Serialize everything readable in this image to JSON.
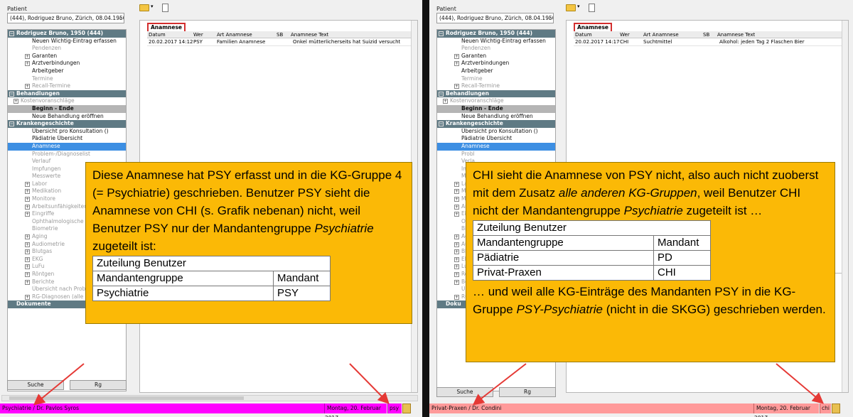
{
  "left": {
    "patient_label": "Patient",
    "patient_value": "(444), Rodriguez Bruno, Zürich, 08.04.1950, €",
    "tree": [
      {
        "kind": "hdr",
        "toggle": "⊟",
        "text": "Rodriguez Bruno, 1950 (444)"
      },
      {
        "kind": "item",
        "text": "Neuen Wichtig-Eintrag erfassen"
      },
      {
        "kind": "dis",
        "text": "Pendenzen"
      },
      {
        "kind": "item",
        "toggle": "+",
        "text": "Garanten"
      },
      {
        "kind": "item",
        "toggle": "+",
        "text": "Arztverbindungen"
      },
      {
        "kind": "item",
        "text": "Arbeitgeber"
      },
      {
        "kind": "dis",
        "text": "Termine"
      },
      {
        "kind": "dis",
        "toggle": "+",
        "text": "Recall-Termine"
      },
      {
        "kind": "hdr",
        "toggle": "⊟",
        "text": "Behandlungen"
      },
      {
        "kind": "dis2",
        "toggle": "+",
        "text": "Kostenvoranschläge"
      },
      {
        "kind": "hdr2",
        "text": "Beginn     - Ende"
      },
      {
        "kind": "item",
        "text": "Neue Behandlung eröffnen"
      },
      {
        "kind": "hdr",
        "toggle": "⊟",
        "text": "Krankengeschichte"
      },
      {
        "kind": "item",
        "text": "Übersicht pro Konsultation ()"
      },
      {
        "kind": "item",
        "text": "Pädiatrie Übersicht"
      },
      {
        "kind": "sel",
        "text": "Anamnese"
      },
      {
        "kind": "dis",
        "text": "Problem-/Diagnoselist"
      },
      {
        "kind": "dis",
        "text": "Verlauf"
      },
      {
        "kind": "dis",
        "text": "Impfungen"
      },
      {
        "kind": "dis",
        "text": "Messwerte"
      },
      {
        "kind": "dis",
        "toggle": "+",
        "text": "Labor"
      },
      {
        "kind": "dis",
        "toggle": "+",
        "text": "Medikation"
      },
      {
        "kind": "dis",
        "toggle": "+",
        "text": "Monitore"
      },
      {
        "kind": "dis",
        "toggle": "+",
        "text": "Arbeitsunfähigkeiten"
      },
      {
        "kind": "dis",
        "toggle": "+",
        "text": "Eingriffe"
      },
      {
        "kind": "dis",
        "text": "Ophthalmologische Mes"
      },
      {
        "kind": "dis",
        "text": "Biometrie"
      },
      {
        "kind": "dis",
        "toggle": "+",
        "text": "Aging"
      },
      {
        "kind": "dis",
        "toggle": "+",
        "text": "Audiometrie"
      },
      {
        "kind": "dis",
        "toggle": "+",
        "text": "Blutgas"
      },
      {
        "kind": "dis",
        "toggle": "+",
        "text": "EKG"
      },
      {
        "kind": "dis",
        "toggle": "+",
        "text": "LuFu"
      },
      {
        "kind": "dis",
        "toggle": "+",
        "text": "Röntgen"
      },
      {
        "kind": "dis",
        "toggle": "+",
        "text": "Berichte"
      },
      {
        "kind": "dis",
        "text": "Übersicht nach Problem"
      },
      {
        "kind": "dis",
        "toggle": "+",
        "text": "RG-Diagnosen (alle des P"
      },
      {
        "kind": "hdr",
        "text": "Dokumente"
      }
    ],
    "btn_suche": "Suche",
    "btn_rg": "Rg",
    "section_label": "Anamnese",
    "columns": [
      "Datum",
      "Wer",
      "Art Anamnese",
      "SB",
      "Anamnese Text"
    ],
    "row": [
      "20.02.2017 14:12",
      "PSY",
      "Familien Anamnese",
      "",
      "Onkel mütterlicherseits hat Suizid versucht"
    ],
    "status_left": "Psychiatrie / Dr. Pavlos Syros",
    "status_date": "Montag, 20. Februar 2017",
    "status_user": "psy",
    "status_color": "#ff00ff",
    "note_text": "Diese Anamnese hat PSY erfasst und in die KG-Gruppe 4 (= Psychiatrie) geschrieben. Benutzer PSY sieht die Anamnese von CHI (s. Grafik nebenan) nicht, weil Benutzer PSY nur der Mandantengruppe ",
    "note_italic": "Psychiatrie",
    "note_tail": " zugeteilt ist:",
    "table_title": "Zuteilung Benutzer",
    "table_head": [
      "Mandantengruppe",
      "Mandant"
    ],
    "table_rows": [
      [
        "Psychiatrie",
        "PSY"
      ]
    ]
  },
  "right": {
    "patient_label": "Patient",
    "patient_value": "(444), Rodriguez Bruno, Zürich, 08.04.1950, €",
    "tree": [
      {
        "kind": "hdr",
        "toggle": "⊟",
        "text": "Rodriguez Bruno, 1950 (444)"
      },
      {
        "kind": "item",
        "text": "Neuen Wichtig-Eintrag erfassen"
      },
      {
        "kind": "dis",
        "text": "Pendenzen"
      },
      {
        "kind": "item",
        "toggle": "+",
        "text": "Garanten"
      },
      {
        "kind": "item",
        "toggle": "+",
        "text": "Arztverbindungen"
      },
      {
        "kind": "item",
        "text": "Arbeitgeber"
      },
      {
        "kind": "dis",
        "text": "Termine"
      },
      {
        "kind": "dis",
        "toggle": "+",
        "text": "Recall-Termine"
      },
      {
        "kind": "hdr",
        "toggle": "⊟",
        "text": "Behandlungen"
      },
      {
        "kind": "dis2",
        "toggle": "+",
        "text": "Kostenvoranschläge"
      },
      {
        "kind": "hdr2",
        "text": "Beginn     - Ende"
      },
      {
        "kind": "item",
        "text": "Neue Behandlung eröffnen"
      },
      {
        "kind": "hdr",
        "toggle": "⊟",
        "text": "Krankengeschichte"
      },
      {
        "kind": "item",
        "text": "Übersicht pro Konsultation ()"
      },
      {
        "kind": "item",
        "text": "Pädiatrie Übersicht"
      },
      {
        "kind": "sel",
        "text": "Anamnese"
      },
      {
        "kind": "dis",
        "text": "Probl"
      },
      {
        "kind": "dis",
        "text": "Verla"
      },
      {
        "kind": "dis",
        "text": "Impf"
      },
      {
        "kind": "dis",
        "text": "Mess"
      },
      {
        "kind": "dis",
        "toggle": "+",
        "text": "Labo"
      },
      {
        "kind": "dis",
        "toggle": "+",
        "text": "Medi"
      },
      {
        "kind": "dis",
        "toggle": "+",
        "text": "Moni"
      },
      {
        "kind": "dis",
        "toggle": "+",
        "text": "Arbe"
      },
      {
        "kind": "dis",
        "toggle": "+",
        "text": "Eingr"
      },
      {
        "kind": "dis",
        "text": "Opht"
      },
      {
        "kind": "dis",
        "text": "Biom"
      },
      {
        "kind": "dis",
        "toggle": "+",
        "text": "Agin"
      },
      {
        "kind": "dis",
        "toggle": "+",
        "text": "Audi"
      },
      {
        "kind": "dis",
        "toggle": "+",
        "text": "Blutg"
      },
      {
        "kind": "dis",
        "toggle": "+",
        "text": "EKG"
      },
      {
        "kind": "dis",
        "toggle": "+",
        "text": "LuFu"
      },
      {
        "kind": "dis",
        "toggle": "+",
        "text": "Rönt"
      },
      {
        "kind": "dis",
        "toggle": "+",
        "text": "Beric"
      },
      {
        "kind": "dis",
        "text": "Über"
      },
      {
        "kind": "dis",
        "toggle": "+",
        "text": "RG-D"
      },
      {
        "kind": "hdr",
        "text": "Doku"
      }
    ],
    "btn_suche": "Suche",
    "btn_rg": "Rg",
    "section_label": "Anamnese",
    "columns": [
      "Datum",
      "Wer",
      "Art Anamnese",
      "SB",
      "Anamnese Text"
    ],
    "row": [
      "20.02.2017 14:17",
      "CHI",
      "Suchtmittel",
      "",
      "Alkohol: jeden Tag 2 Flaschen Bier"
    ],
    "status_left": "Privat-Praxen / Dr. Condini",
    "status_date": "Montag, 20. Februar 2017",
    "status_user": "chi",
    "status_color": "#ff9a9a",
    "note_a": "CHI sieht die Anamnese von PSY nicht, also auch nicht zuoberst mit dem Zusatz ",
    "note_a_italic": "alle anderen KG-Gruppen",
    "note_a_tail": ", weil Benutzer CHI nicht der Mandantengruppe ",
    "note_b_italic": "Psychiatrie",
    "note_b_tail": " zugeteilt ist …",
    "table_title": "Zuteilung Benutzer",
    "table_head": [
      "Mandantengruppe",
      "Mandant"
    ],
    "table_rows": [
      [
        "Pädiatrie",
        "PD"
      ],
      [
        "Privat-Praxen",
        "CHI"
      ]
    ],
    "note_c": "… und weil alle KG-Einträge des Mandanten PSY in die KG-Gruppe ",
    "note_c_italic": "PSY-Psychiatrie",
    "note_c_tail": " (nicht in die SKGG) geschrieben werden."
  }
}
